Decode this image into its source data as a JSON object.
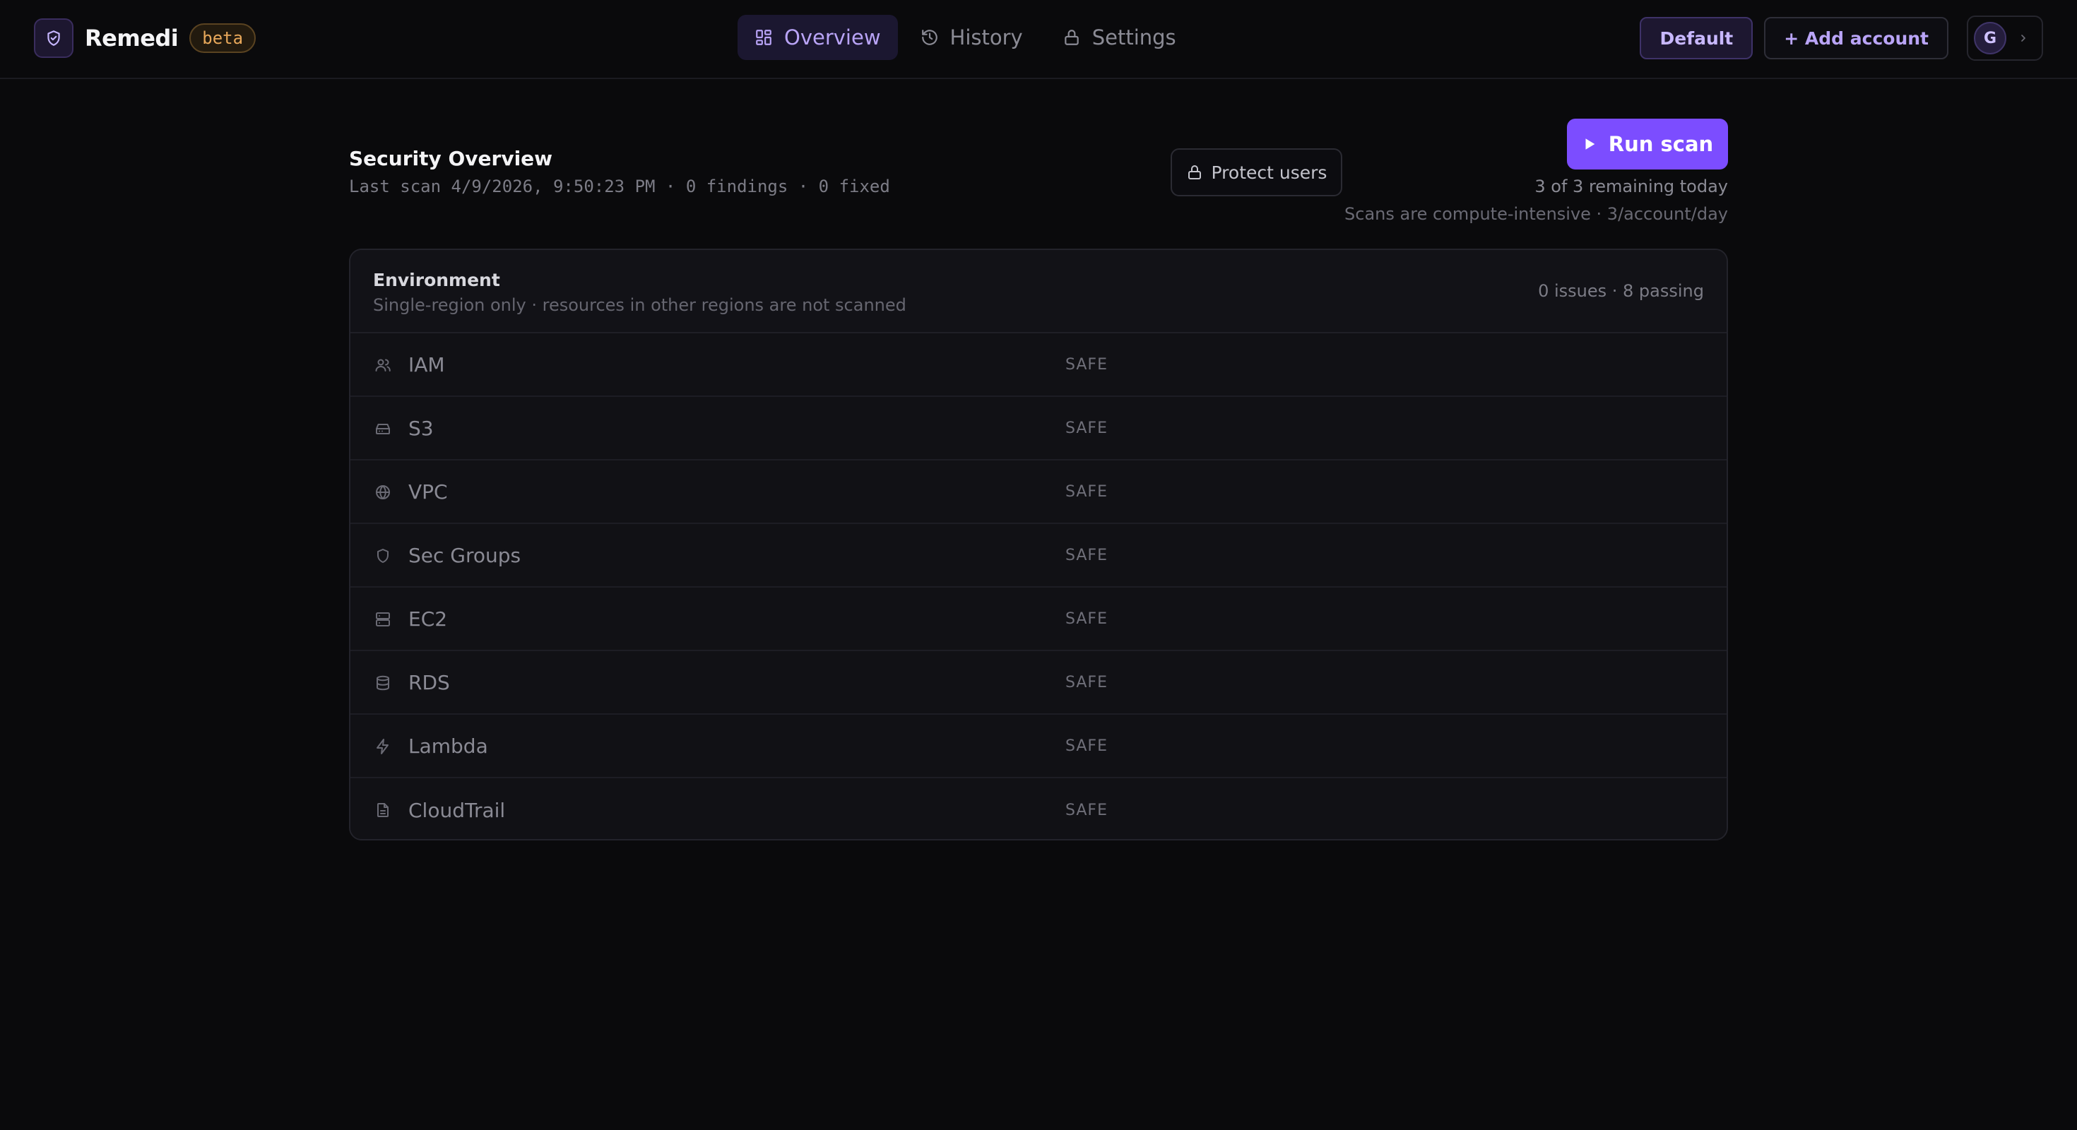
{
  "brand": {
    "name": "Remedi",
    "badge": "beta",
    "logo_icon": "shield-check-icon"
  },
  "nav": {
    "tabs": [
      {
        "label": "Overview",
        "icon": "grid-icon",
        "active": true
      },
      {
        "label": "History",
        "icon": "history-icon",
        "active": false
      },
      {
        "label": "Settings",
        "icon": "lock-icon",
        "active": false
      }
    ]
  },
  "account": {
    "profile_label": "Default",
    "add_label": "+ Add account",
    "avatar_initial": "G"
  },
  "overview": {
    "title": "Security Overview",
    "last_scan": "Last scan 4/9/2026, 9:50:23 PM · 0 findings · 0 fixed",
    "protect_label": "Protect users",
    "run_label": "Run scan",
    "remaining": "3 of 3 remaining today",
    "scan_note": "Scans are compute-intensive · 3/account/day"
  },
  "environment": {
    "title": "Environment",
    "subtitle": "Single-region only · resources in other regions are not scanned",
    "status": "0 issues · 8 passing",
    "services": [
      {
        "name": "IAM",
        "status": "SAFE",
        "icon": "users-icon"
      },
      {
        "name": "S3",
        "status": "SAFE",
        "icon": "bucket-icon"
      },
      {
        "name": "VPC",
        "status": "SAFE",
        "icon": "globe-icon"
      },
      {
        "name": "Sec Groups",
        "status": "SAFE",
        "icon": "shield-icon"
      },
      {
        "name": "EC2",
        "status": "SAFE",
        "icon": "server-icon"
      },
      {
        "name": "RDS",
        "status": "SAFE",
        "icon": "database-icon"
      },
      {
        "name": "Lambda",
        "status": "SAFE",
        "icon": "bolt-icon"
      },
      {
        "name": "CloudTrail",
        "status": "SAFE",
        "icon": "file-icon"
      }
    ]
  },
  "colors": {
    "background": "#0a0a0c",
    "accent": "#7c4dff",
    "accent_text": "#b9a4f7",
    "badge": "#e8a85a"
  }
}
